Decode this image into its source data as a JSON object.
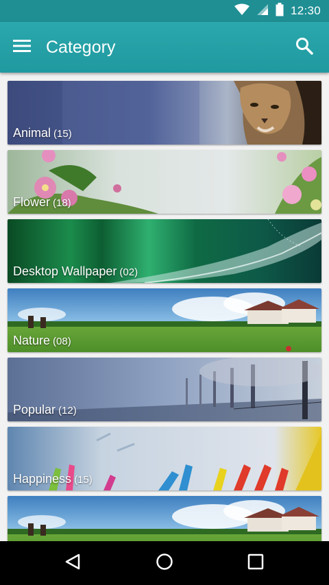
{
  "status_bar": {
    "time": "12:30",
    "icons": [
      "wifi-icon",
      "cell-signal-icon",
      "battery-icon"
    ]
  },
  "app_bar": {
    "title": "Category",
    "menu_icon": "hamburger-menu-icon",
    "search_icon": "search-icon"
  },
  "categories": [
    {
      "name": "Animal",
      "count": "(15)",
      "scene": "cougar"
    },
    {
      "name": "Flower",
      "count": "(18)",
      "scene": "pink-flowers"
    },
    {
      "name": "Desktop Wallpaper",
      "count": "(02)",
      "scene": "green-aurora"
    },
    {
      "name": "Nature",
      "count": "(08)",
      "scene": "green-field"
    },
    {
      "name": "Popular",
      "count": "(12)",
      "scene": "misty-trees"
    },
    {
      "name": "Happiness",
      "count": "(15)",
      "scene": "painted-hands"
    },
    {
      "name": "",
      "count": "",
      "scene": "green-field"
    }
  ],
  "nav_bar": {
    "back_icon": "back-triangle-icon",
    "home_icon": "home-circle-icon",
    "recents_icon": "recents-square-icon"
  },
  "colors": {
    "status_bar": "#1f8f94",
    "app_bar": "#24a0a6",
    "background": "#f2f2f2"
  }
}
